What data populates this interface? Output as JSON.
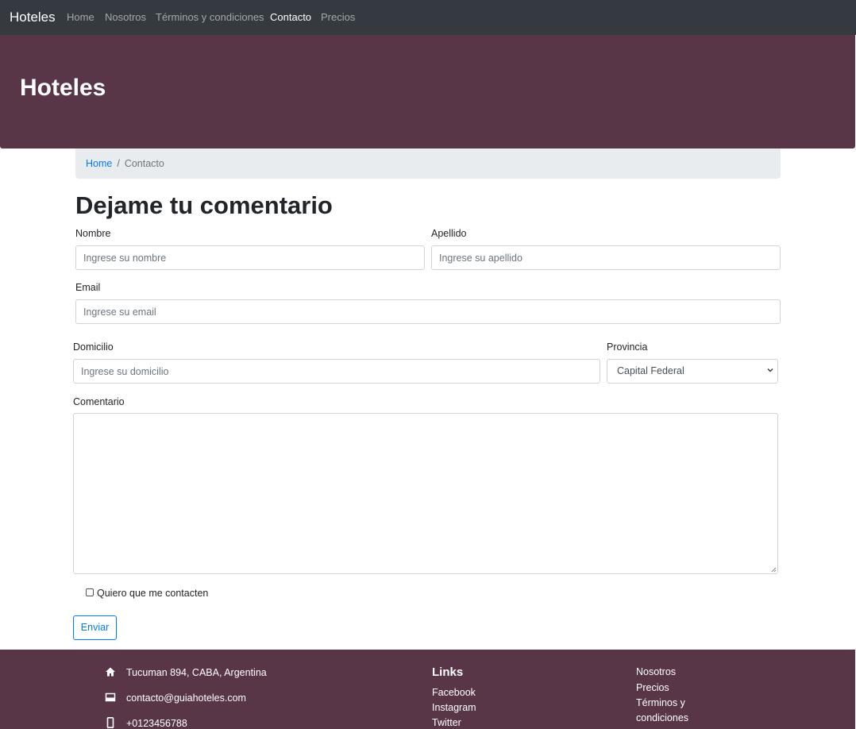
{
  "navbar": {
    "brand": "Hoteles",
    "links": [
      "Home",
      "Nosotros",
      "Términos y condiciones",
      "Contacto",
      "Precios"
    ],
    "active": "Contacto"
  },
  "hero": {
    "title": "Hoteles"
  },
  "breadcrumb": {
    "home": "Home",
    "separator": "/",
    "current": "Contacto"
  },
  "form": {
    "title": "Dejame tu comentario",
    "nombre": {
      "label": "Nombre",
      "placeholder": "Ingrese su nombre"
    },
    "apellido": {
      "label": "Apellido",
      "placeholder": "Ingrese su apellido"
    },
    "email": {
      "label": "Email",
      "placeholder": "Ingrese su email"
    },
    "domicilio": {
      "label": "Domicilio",
      "placeholder": "Ingrese su domicilio"
    },
    "provincia": {
      "label": "Provincia",
      "value": "Capital Federal"
    },
    "comentario": {
      "label": "Comentario"
    },
    "checkbox_label": "Quiero que me contacten",
    "submit": "Enviar"
  },
  "footer": {
    "address": "Tucuman 894, CABA, Argentina",
    "email": "contacto@guiahoteles.com",
    "phone": "+0123456788",
    "links_title": "Links",
    "social": [
      "Facebook",
      "Instagram",
      "Twitter"
    ],
    "nav": [
      "Nosotros",
      "Precios",
      "Términos y condiciones"
    ]
  },
  "colors": {
    "navbar": "#343a40",
    "brand_purple": "#583648",
    "primary": "#007bff",
    "breadcrumb_bg": "#e9ecef"
  }
}
